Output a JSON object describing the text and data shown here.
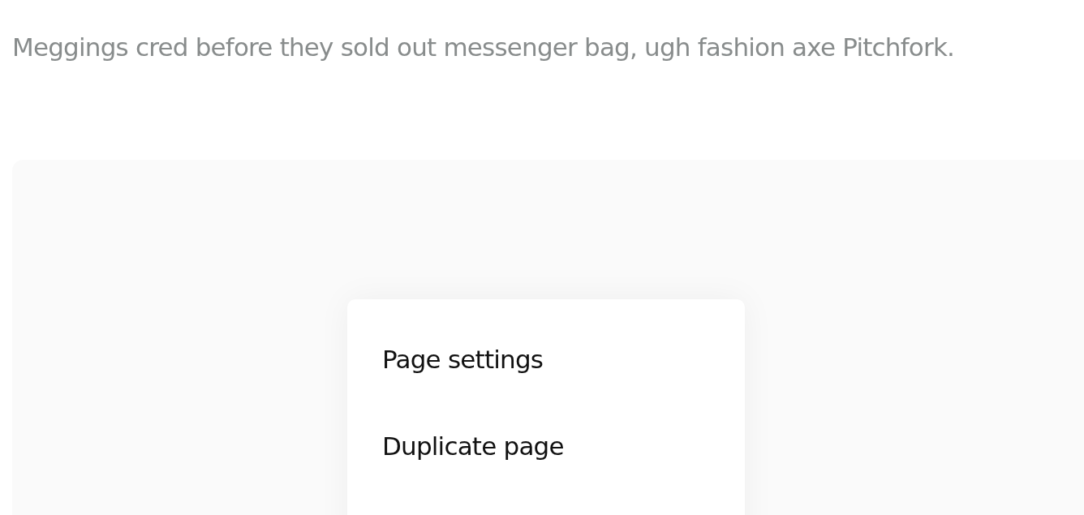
{
  "subtitle": "Meggings cred before they sold out messenger bag, ugh fashion axe Pitchfork.",
  "menu": {
    "items": [
      {
        "label": "Page settings"
      },
      {
        "label": "Duplicate page"
      }
    ]
  }
}
